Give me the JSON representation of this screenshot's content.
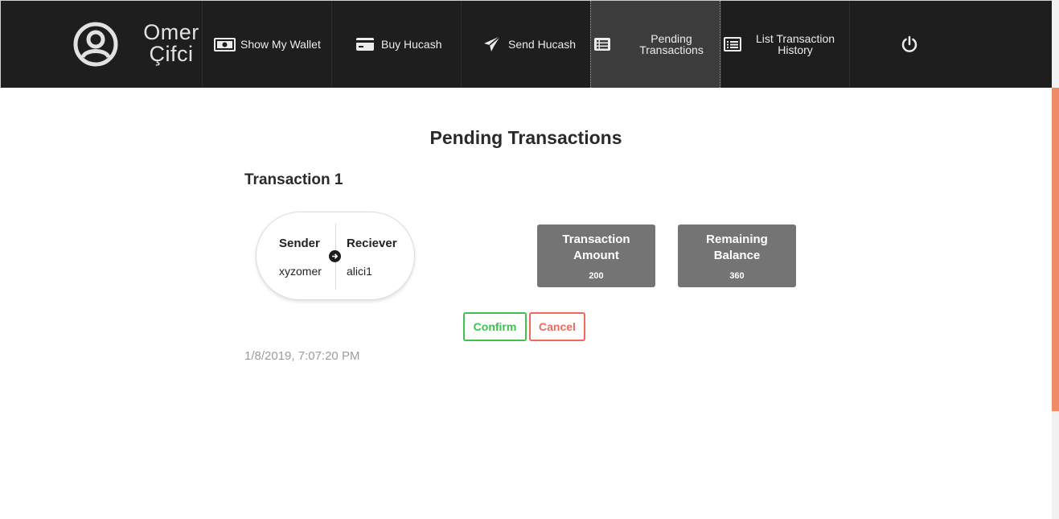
{
  "user": {
    "first_name": "Omer",
    "last_name": "Çifci",
    "avatar_icon": "user-circle-icon"
  },
  "nav": {
    "items": [
      {
        "label": "Show My Wallet",
        "icon": "money-bill-icon"
      },
      {
        "label": "Buy Hucash",
        "icon": "credit-card-icon"
      },
      {
        "label": "Send Hucash",
        "icon": "paper-plane-icon"
      },
      {
        "label": "Pending Transactions",
        "icon": "list-alt-icon",
        "active": true
      },
      {
        "label": "List Transaction History",
        "icon": "list-icon"
      }
    ],
    "logout_icon": "power-icon"
  },
  "page": {
    "title": "Pending Transactions"
  },
  "transaction": {
    "title": "Transaction 1",
    "sender_label": "Sender",
    "sender": "xyzomer",
    "receiver_label": "Reciever",
    "receiver": "alici1",
    "amount_label": "Transaction Amount",
    "amount": "200",
    "balance_label": "Remaining Balance",
    "balance": "360",
    "confirm_label": "Confirm",
    "cancel_label": "Cancel",
    "timestamp": "1/8/2019, 7:07:20 PM"
  },
  "colors": {
    "navbar": "#1e1e1f",
    "active_nav": "#3c3c3d",
    "confirm": "#3ec14e",
    "cancel": "#ee6b5c",
    "box": "#747474",
    "scroll_thumb": "#ef8b66"
  }
}
